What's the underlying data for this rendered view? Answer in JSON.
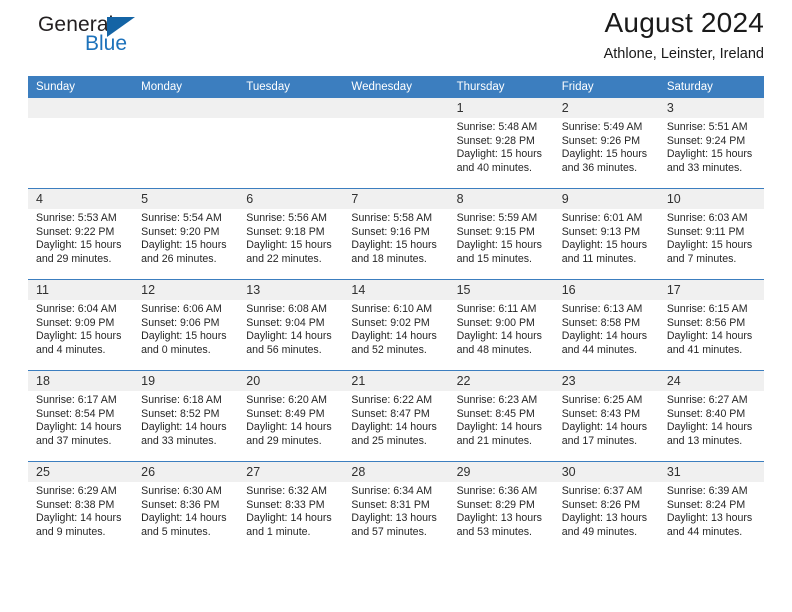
{
  "brand": {
    "name_top": "General",
    "name_bottom": "Blue",
    "accent_color": "#1d72bb",
    "flag_color": "#1464a5"
  },
  "header": {
    "title": "August 2024",
    "location": "Athlone, Leinster, Ireland"
  },
  "calendar": {
    "header_bg": "#3c7ebf",
    "daynum_band_bg": "#f0f0f0",
    "weekday_headers": [
      "Sunday",
      "Monday",
      "Tuesday",
      "Wednesday",
      "Thursday",
      "Friday",
      "Saturday"
    ],
    "weeks": [
      [
        {
          "day": ""
        },
        {
          "day": ""
        },
        {
          "day": ""
        },
        {
          "day": ""
        },
        {
          "day": "1",
          "sunrise": "Sunrise: 5:48 AM",
          "sunset": "Sunset: 9:28 PM",
          "daylight_1": "Daylight: 15 hours",
          "daylight_2": "and 40 minutes."
        },
        {
          "day": "2",
          "sunrise": "Sunrise: 5:49 AM",
          "sunset": "Sunset: 9:26 PM",
          "daylight_1": "Daylight: 15 hours",
          "daylight_2": "and 36 minutes."
        },
        {
          "day": "3",
          "sunrise": "Sunrise: 5:51 AM",
          "sunset": "Sunset: 9:24 PM",
          "daylight_1": "Daylight: 15 hours",
          "daylight_2": "and 33 minutes."
        }
      ],
      [
        {
          "day": "4",
          "sunrise": "Sunrise: 5:53 AM",
          "sunset": "Sunset: 9:22 PM",
          "daylight_1": "Daylight: 15 hours",
          "daylight_2": "and 29 minutes."
        },
        {
          "day": "5",
          "sunrise": "Sunrise: 5:54 AM",
          "sunset": "Sunset: 9:20 PM",
          "daylight_1": "Daylight: 15 hours",
          "daylight_2": "and 26 minutes."
        },
        {
          "day": "6",
          "sunrise": "Sunrise: 5:56 AM",
          "sunset": "Sunset: 9:18 PM",
          "daylight_1": "Daylight: 15 hours",
          "daylight_2": "and 22 minutes."
        },
        {
          "day": "7",
          "sunrise": "Sunrise: 5:58 AM",
          "sunset": "Sunset: 9:16 PM",
          "daylight_1": "Daylight: 15 hours",
          "daylight_2": "and 18 minutes."
        },
        {
          "day": "8",
          "sunrise": "Sunrise: 5:59 AM",
          "sunset": "Sunset: 9:15 PM",
          "daylight_1": "Daylight: 15 hours",
          "daylight_2": "and 15 minutes."
        },
        {
          "day": "9",
          "sunrise": "Sunrise: 6:01 AM",
          "sunset": "Sunset: 9:13 PM",
          "daylight_1": "Daylight: 15 hours",
          "daylight_2": "and 11 minutes."
        },
        {
          "day": "10",
          "sunrise": "Sunrise: 6:03 AM",
          "sunset": "Sunset: 9:11 PM",
          "daylight_1": "Daylight: 15 hours",
          "daylight_2": "and 7 minutes."
        }
      ],
      [
        {
          "day": "11",
          "sunrise": "Sunrise: 6:04 AM",
          "sunset": "Sunset: 9:09 PM",
          "daylight_1": "Daylight: 15 hours",
          "daylight_2": "and 4 minutes."
        },
        {
          "day": "12",
          "sunrise": "Sunrise: 6:06 AM",
          "sunset": "Sunset: 9:06 PM",
          "daylight_1": "Daylight: 15 hours",
          "daylight_2": "and 0 minutes."
        },
        {
          "day": "13",
          "sunrise": "Sunrise: 6:08 AM",
          "sunset": "Sunset: 9:04 PM",
          "daylight_1": "Daylight: 14 hours",
          "daylight_2": "and 56 minutes."
        },
        {
          "day": "14",
          "sunrise": "Sunrise: 6:10 AM",
          "sunset": "Sunset: 9:02 PM",
          "daylight_1": "Daylight: 14 hours",
          "daylight_2": "and 52 minutes."
        },
        {
          "day": "15",
          "sunrise": "Sunrise: 6:11 AM",
          "sunset": "Sunset: 9:00 PM",
          "daylight_1": "Daylight: 14 hours",
          "daylight_2": "and 48 minutes."
        },
        {
          "day": "16",
          "sunrise": "Sunrise: 6:13 AM",
          "sunset": "Sunset: 8:58 PM",
          "daylight_1": "Daylight: 14 hours",
          "daylight_2": "and 44 minutes."
        },
        {
          "day": "17",
          "sunrise": "Sunrise: 6:15 AM",
          "sunset": "Sunset: 8:56 PM",
          "daylight_1": "Daylight: 14 hours",
          "daylight_2": "and 41 minutes."
        }
      ],
      [
        {
          "day": "18",
          "sunrise": "Sunrise: 6:17 AM",
          "sunset": "Sunset: 8:54 PM",
          "daylight_1": "Daylight: 14 hours",
          "daylight_2": "and 37 minutes."
        },
        {
          "day": "19",
          "sunrise": "Sunrise: 6:18 AM",
          "sunset": "Sunset: 8:52 PM",
          "daylight_1": "Daylight: 14 hours",
          "daylight_2": "and 33 minutes."
        },
        {
          "day": "20",
          "sunrise": "Sunrise: 6:20 AM",
          "sunset": "Sunset: 8:49 PM",
          "daylight_1": "Daylight: 14 hours",
          "daylight_2": "and 29 minutes."
        },
        {
          "day": "21",
          "sunrise": "Sunrise: 6:22 AM",
          "sunset": "Sunset: 8:47 PM",
          "daylight_1": "Daylight: 14 hours",
          "daylight_2": "and 25 minutes."
        },
        {
          "day": "22",
          "sunrise": "Sunrise: 6:23 AM",
          "sunset": "Sunset: 8:45 PM",
          "daylight_1": "Daylight: 14 hours",
          "daylight_2": "and 21 minutes."
        },
        {
          "day": "23",
          "sunrise": "Sunrise: 6:25 AM",
          "sunset": "Sunset: 8:43 PM",
          "daylight_1": "Daylight: 14 hours",
          "daylight_2": "and 17 minutes."
        },
        {
          "day": "24",
          "sunrise": "Sunrise: 6:27 AM",
          "sunset": "Sunset: 8:40 PM",
          "daylight_1": "Daylight: 14 hours",
          "daylight_2": "and 13 minutes."
        }
      ],
      [
        {
          "day": "25",
          "sunrise": "Sunrise: 6:29 AM",
          "sunset": "Sunset: 8:38 PM",
          "daylight_1": "Daylight: 14 hours",
          "daylight_2": "and 9 minutes."
        },
        {
          "day": "26",
          "sunrise": "Sunrise: 6:30 AM",
          "sunset": "Sunset: 8:36 PM",
          "daylight_1": "Daylight: 14 hours",
          "daylight_2": "and 5 minutes."
        },
        {
          "day": "27",
          "sunrise": "Sunrise: 6:32 AM",
          "sunset": "Sunset: 8:33 PM",
          "daylight_1": "Daylight: 14 hours",
          "daylight_2": "and 1 minute."
        },
        {
          "day": "28",
          "sunrise": "Sunrise: 6:34 AM",
          "sunset": "Sunset: 8:31 PM",
          "daylight_1": "Daylight: 13 hours",
          "daylight_2": "and 57 minutes."
        },
        {
          "day": "29",
          "sunrise": "Sunrise: 6:36 AM",
          "sunset": "Sunset: 8:29 PM",
          "daylight_1": "Daylight: 13 hours",
          "daylight_2": "and 53 minutes."
        },
        {
          "day": "30",
          "sunrise": "Sunrise: 6:37 AM",
          "sunset": "Sunset: 8:26 PM",
          "daylight_1": "Daylight: 13 hours",
          "daylight_2": "and 49 minutes."
        },
        {
          "day": "31",
          "sunrise": "Sunrise: 6:39 AM",
          "sunset": "Sunset: 8:24 PM",
          "daylight_1": "Daylight: 13 hours",
          "daylight_2": "and 44 minutes."
        }
      ]
    ]
  }
}
